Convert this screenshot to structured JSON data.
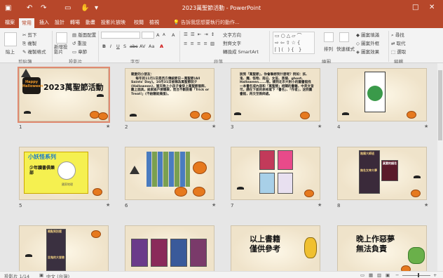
{
  "window": {
    "title": "2023萬聖節活動 - PowerPoint",
    "qa_icons": [
      "save-icon",
      "undo-icon",
      "redo-icon",
      "present-icon",
      "touch-mode-icon",
      "customize-icon"
    ],
    "help_icon": "?",
    "restore_icon": "□",
    "close_icon": "✕"
  },
  "tabs": [
    {
      "label": "檔案"
    },
    {
      "label": "常用"
    },
    {
      "label": "插入"
    },
    {
      "label": "設計"
    },
    {
      "label": "轉場"
    },
    {
      "label": "動畫"
    },
    {
      "label": "投影片放映"
    },
    {
      "label": "校閱"
    },
    {
      "label": "檢視"
    }
  ],
  "active_tab": "常用",
  "tell_me": "告訴我您想要執行的動作...",
  "ribbon": {
    "clipboard": {
      "paste": "貼上",
      "cut": "剪下",
      "copy": "複製",
      "format_painter": "複製格式",
      "label": "剪貼簿"
    },
    "slides": {
      "new_slide": "新增投影片",
      "layout": "版面配置",
      "reset": "重設",
      "section": "章節",
      "label": "投影片"
    },
    "font": {
      "grow": "A",
      "shrink": "A",
      "clear": "A",
      "bold": "B",
      "italic": "I",
      "underline": "U",
      "shadow": "S",
      "strike": "abc",
      "spacing": "AV",
      "case": "Aa",
      "color": "A",
      "label": "字型"
    },
    "paragraph": {
      "direction": "文字方向",
      "align_text": "對齊文字",
      "smartart": "轉換成 SmartArt",
      "label": "段落"
    },
    "drawing": {
      "arrange": "排列",
      "quick_styles": "快速樣式",
      "fill": "圖案填滿",
      "outline": "圖案外框",
      "effects": "圖案效果",
      "label": "繪圖"
    },
    "editing": {
      "find": "尋找",
      "replace": "取代",
      "select": "選取",
      "label": "編輯"
    }
  },
  "slides": [
    {
      "num": "1",
      "title": "2023萬聖節活動",
      "badge": "Happy Halloween"
    },
    {
      "num": "2",
      "text": "親愛的小朋友：\n    每年的11月1日是西方傳統節日－萬聖節(All Saints' Day)。10月31日被稱為萬聖節前夕(Halloween)，當天晚上小孩子會穿上萬聖節服飾，戴上面具，挨家挨戶要糖果，而且不斷說著「Trick or Treat!」(不給糖就搗蛋)。"
    },
    {
      "num": "3",
      "text": "說到「萬聖節」，你會聯想到什麼呢？例如：妖、鬼、魔、怪物、南瓜、女巫、黑貓、ghost、Halloween......等。請到北市大附小的圖書館找一本書名或內容和「萬聖節」相關的書籍，中英文皆可。請在下面的表格寫下「書名」、「作者」，送到圖書館，再交至教師處。"
    },
    {
      "num": "4",
      "text": ""
    },
    {
      "num": "5",
      "title": "小妖怪系列",
      "sub": "少年讀書俱樂部",
      "tag": "國家地理"
    },
    {
      "num": "6",
      "text": ""
    },
    {
      "num": "7",
      "text": ""
    },
    {
      "num": "8",
      "t1": "陰陽大師班",
      "t2": "無名女神大學",
      "t3": "真實的錢花"
    },
    {
      "num": "9",
      "t1": "晚點到別館",
      "t2": "吉鬼的大冒險"
    },
    {
      "num": "10",
      "text": ""
    },
    {
      "num": "11",
      "title": "以上書籍\n僅供參考"
    },
    {
      "num": "12",
      "title": "晚上作惡夢\n無法負責"
    }
  ],
  "star": "★",
  "status": {
    "slide_info": "投影片 1/14",
    "lang": "中文 (台灣)",
    "zoom_minus": "−",
    "zoom_plus": "+"
  }
}
